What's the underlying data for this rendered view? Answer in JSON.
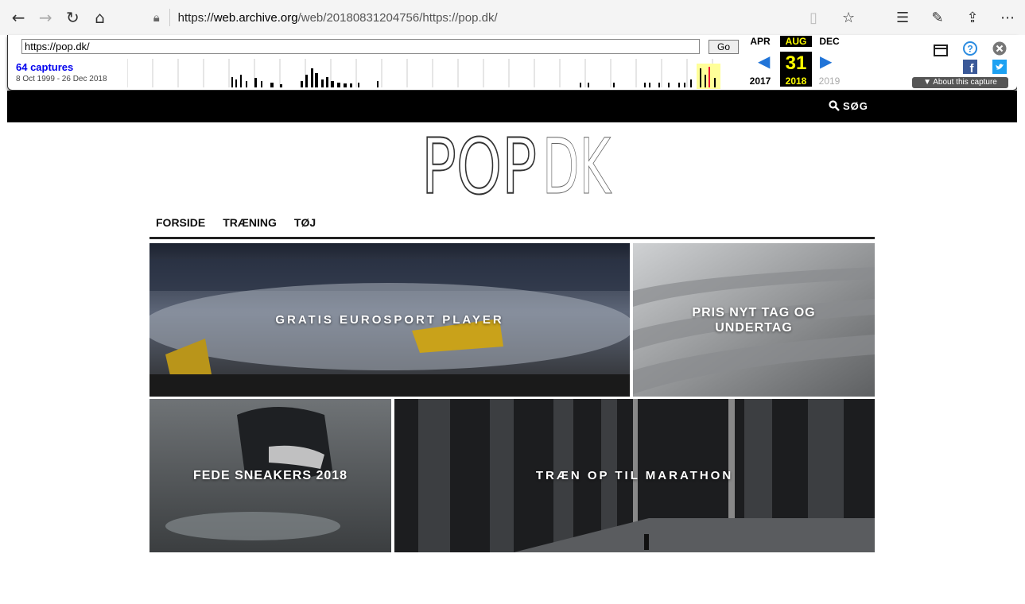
{
  "browser": {
    "url_prefix": "https://",
    "url_host": "web.archive.org",
    "url_rest": "/web/20180831204756/https://pop.dk/"
  },
  "wayback": {
    "url_input": "https://pop.dk/",
    "go_label": "Go",
    "captures": "64 captures",
    "range": "8 Oct 1999 - 26 Dec 2018",
    "months": [
      "APR",
      "AUG",
      "DEC"
    ],
    "day": "31",
    "years": [
      "2017",
      "2018",
      "2019"
    ],
    "about": "About this capture"
  },
  "site": {
    "search": "SØG",
    "logo_bold": "POP",
    "logo_light": "DK",
    "menu": [
      "FORSIDE",
      "TRÆNING",
      "TØJ"
    ],
    "tiles": [
      {
        "label": "GRATIS EUROSPORT PLAYER"
      },
      {
        "label": "PRIS NYT TAG OG UNDERTAG"
      },
      {
        "label": "FEDE SNEAKERS 2018"
      },
      {
        "label": "TRÆN OP TIL MARATHON"
      }
    ]
  }
}
